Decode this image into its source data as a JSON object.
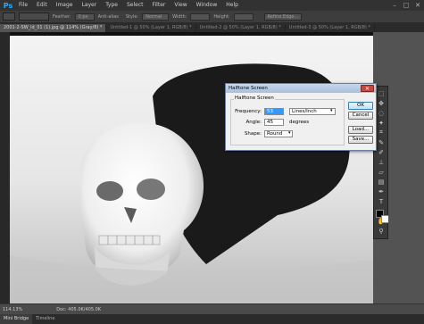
{
  "app": {
    "logo": "Ps"
  },
  "menu": [
    "File",
    "Edit",
    "Image",
    "Layer",
    "Type",
    "Select",
    "Filter",
    "View",
    "Window",
    "Help"
  ],
  "options_bar": {
    "feather_label": "Feather:",
    "feather_value": "0 px",
    "antialias_label": "Anti-alias",
    "style_label": "Style:",
    "style_value": "Normal",
    "width_label": "Width:",
    "height_label": "Height:",
    "refine_edge": "Refine Edge..."
  },
  "tabs": [
    {
      "label": "2001-2-SW_ld_01 (1).jpg @ 114% (Gray/8) *",
      "active": true
    },
    {
      "label": "Untitled-1 @ 50% (Layer 1, RGB/8) *",
      "active": false
    },
    {
      "label": "Untitled-2 @ 50% (Layer 1, RGB/8) *",
      "active": false
    },
    {
      "label": "Untitled-3 @ 50% (Layer 1, RGB/8) *",
      "active": false
    }
  ],
  "dialog": {
    "title": "Halftone Screen",
    "group_label": "Halftone Screen",
    "frequency_label": "Frequency:",
    "frequency_value": "53",
    "frequency_unit": "Lines/Inch",
    "angle_label": "Angle:",
    "angle_value": "45",
    "angle_unit": "degrees",
    "shape_label": "Shape:",
    "shape_value": "Round",
    "ok": "OK",
    "cancel": "Cancel",
    "load": "Load...",
    "save": "Save..."
  },
  "status": {
    "zoom": "114.13%",
    "doc": "Doc: 405.0K/405.0K"
  },
  "bottom_tabs": [
    "Mini Bridge",
    "Timeline"
  ],
  "icons": [
    "minimize-icon",
    "maximize-icon",
    "close-icon",
    "marquee-icon",
    "move-icon",
    "lasso-icon",
    "wand-icon",
    "crop-icon",
    "eyedropper-icon",
    "brush-icon",
    "stamp-icon",
    "eraser-icon",
    "gradient-icon",
    "pen-icon",
    "type-icon",
    "path-select-icon",
    "shape-icon",
    "hand-icon",
    "zoom-icon"
  ]
}
